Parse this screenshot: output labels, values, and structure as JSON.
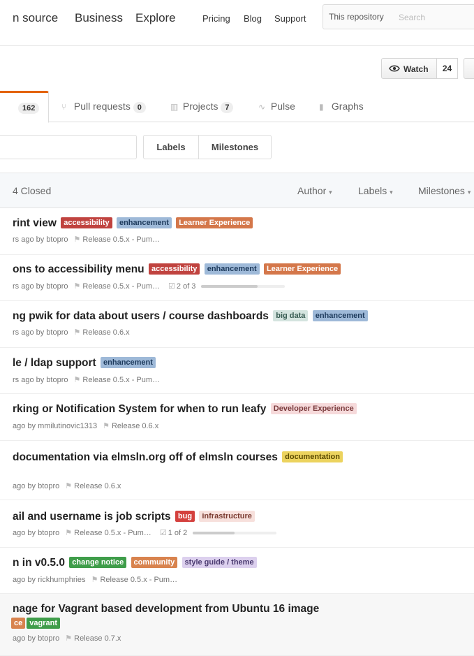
{
  "header": {
    "nav": [
      "n source",
      "Business",
      "Explore"
    ],
    "small_nav": [
      "Pricing",
      "Blog",
      "Support"
    ],
    "search_scope": "This repository",
    "search_placeholder": "Search"
  },
  "repo": {
    "watch_label": "Watch",
    "watch_count": "24"
  },
  "tabs": {
    "issues_count": "162",
    "pulls_label": "Pull requests",
    "pulls_count": "0",
    "projects_label": "Projects",
    "projects_count": "7",
    "pulse_label": "Pulse",
    "graphs_label": "Graphs"
  },
  "filters": {
    "labels": "Labels",
    "milestones": "Milestones"
  },
  "list_header": {
    "closed": "4 Closed",
    "author": "Author",
    "labels": "Labels",
    "milestones": "Milestones"
  },
  "label_colors": {
    "accessibility": {
      "bg": "#c0433f",
      "fg": "#ffffff"
    },
    "enhancement": {
      "bg": "#9eb9d8",
      "fg": "#1d3a5c"
    },
    "learner": {
      "bg": "#d4774a",
      "fg": "#ffffff"
    },
    "bigdata": {
      "bg": "#d4e4df",
      "fg": "#355a50"
    },
    "devexp": {
      "bg": "#f6dadb",
      "fg": "#7a3a3c"
    },
    "documentation": {
      "bg": "#ecd35e",
      "fg": "#5a4a00"
    },
    "bug": {
      "bg": "#d4413e",
      "fg": "#ffffff"
    },
    "infrastructure": {
      "bg": "#f7e0dc",
      "fg": "#7a3a30"
    },
    "changenotice": {
      "bg": "#3f9d4a",
      "fg": "#ffffff"
    },
    "community": {
      "bg": "#d8834e",
      "fg": "#ffffff"
    },
    "styleguide": {
      "bg": "#dcd0ee",
      "fg": "#4a3a70"
    },
    "vagrant": {
      "bg": "#3f9d4a",
      "fg": "#ffffff"
    },
    "ce": {
      "bg": "#d8834e",
      "fg": "#ffffff"
    }
  },
  "issues": [
    {
      "title": "rint view",
      "labels": [
        {
          "text": "accessibility",
          "kind": "accessibility"
        },
        {
          "text": "enhancement",
          "kind": "enhancement"
        },
        {
          "text": "Learner Experience",
          "kind": "learner"
        }
      ],
      "meta": "rs ago by btopro",
      "milestone": "Release 0.5.x - Pum…"
    },
    {
      "title": "ons to accessibility menu",
      "labels": [
        {
          "text": "accessibility",
          "kind": "accessibility"
        },
        {
          "text": "enhancement",
          "kind": "enhancement"
        },
        {
          "text": "Learner Experience",
          "kind": "learner"
        }
      ],
      "meta": "rs ago by btopro",
      "milestone": "Release 0.5.x - Pum…",
      "tasks": "2 of 3",
      "progress": 0.67
    },
    {
      "title": "ng pwik for data about users / course dashboards",
      "labels": [
        {
          "text": "big data",
          "kind": "bigdata"
        },
        {
          "text": "enhancement",
          "kind": "enhancement"
        }
      ],
      "meta": "rs ago by btopro",
      "milestone": "Release 0.6.x"
    },
    {
      "title": "le / ldap support",
      "labels": [
        {
          "text": "enhancement",
          "kind": "enhancement"
        }
      ],
      "meta": "rs ago by btopro",
      "milestone": "Release 0.5.x - Pum…"
    },
    {
      "title": "rking or Notification System for when to run leafy",
      "labels": [
        {
          "text": "Developer Experience",
          "kind": "devexp"
        }
      ],
      "meta": "ago by mmilutinovic1313",
      "milestone": "Release 0.6.x"
    },
    {
      "title": "documentation via elmsln.org off of elmsln courses",
      "labels": [
        {
          "text": "documentation",
          "kind": "documentation"
        }
      ],
      "meta": "ago by btopro",
      "milestone": "Release 0.6.x"
    },
    {
      "title": "ail and username is job scripts",
      "labels": [
        {
          "text": "bug",
          "kind": "bug"
        },
        {
          "text": "infrastructure",
          "kind": "infrastructure"
        }
      ],
      "meta": "ago by btopro",
      "milestone": "Release 0.5.x - Pum…",
      "tasks": "1 of 2",
      "progress": 0.5
    },
    {
      "title": "n in v0.5.0",
      "labels": [
        {
          "text": "change notice",
          "kind": "changenotice"
        },
        {
          "text": "community",
          "kind": "community"
        },
        {
          "text": "style guide / theme",
          "kind": "styleguide"
        }
      ],
      "meta": "ago by rickhumphries",
      "milestone": "Release 0.5.x - Pum…"
    },
    {
      "title": "nage for Vagrant based development from Ubuntu 16 image",
      "labels2": [
        {
          "text": "ce",
          "kind": "ce"
        },
        {
          "text": "vagrant",
          "kind": "vagrant"
        }
      ],
      "meta": "ago by btopro",
      "milestone": "Release 0.7.x"
    }
  ]
}
